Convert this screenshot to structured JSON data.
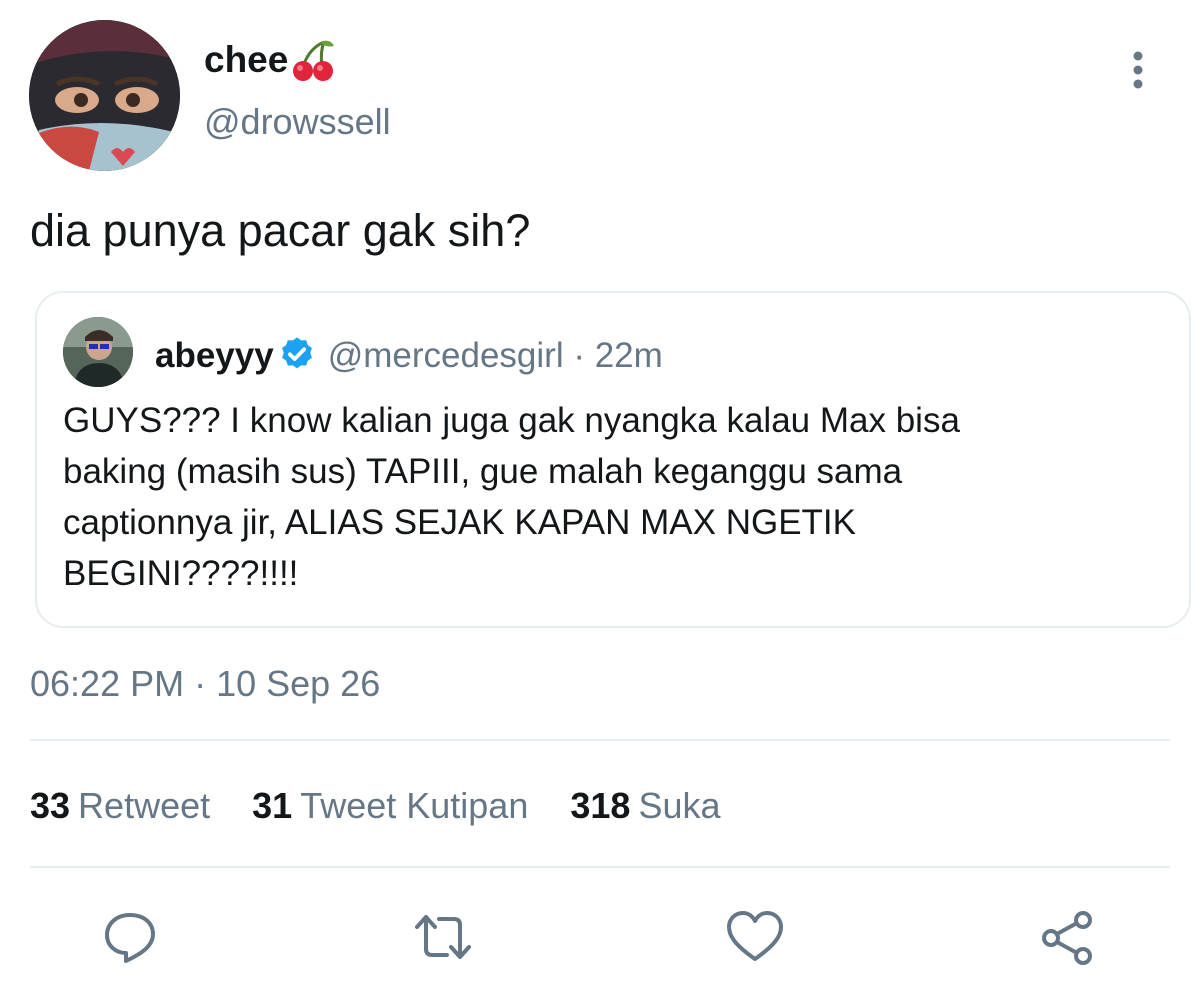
{
  "tweet": {
    "display_name": "chee",
    "name_emoji": "cherries-emoji",
    "handle": "@drowssell",
    "text": "dia punya pacar gak sih?",
    "timestamp": "06:22 PM · 10 Sep 26"
  },
  "quote": {
    "display_name": "abeyyy",
    "verified": true,
    "handle": "@mercedesgirl",
    "separator": "·",
    "time": "22m",
    "text_lines": [
      "GUYS??? I know kalian juga gak nyangka kalau Max bisa",
      "baking (masih sus) TAPIII, gue malah keganggu sama",
      "captionnya jir, ALIAS SEJAK KAPAN MAX NGETIK",
      "BEGINI????!!!!"
    ]
  },
  "stats": {
    "retweets": {
      "count": "33",
      "label": "Retweet"
    },
    "quotes": {
      "count": "31",
      "label": "Tweet Kutipan"
    },
    "likes": {
      "count": "318",
      "label": "Suka"
    }
  },
  "actions": [
    "reply-icon",
    "retweet-icon",
    "like-icon",
    "share-icon"
  ],
  "colors": {
    "text_primary": "#14171a",
    "text_secondary": "#657786",
    "border": "#e6ecf0",
    "icon": "#657786",
    "verified": "#1da1f2"
  }
}
